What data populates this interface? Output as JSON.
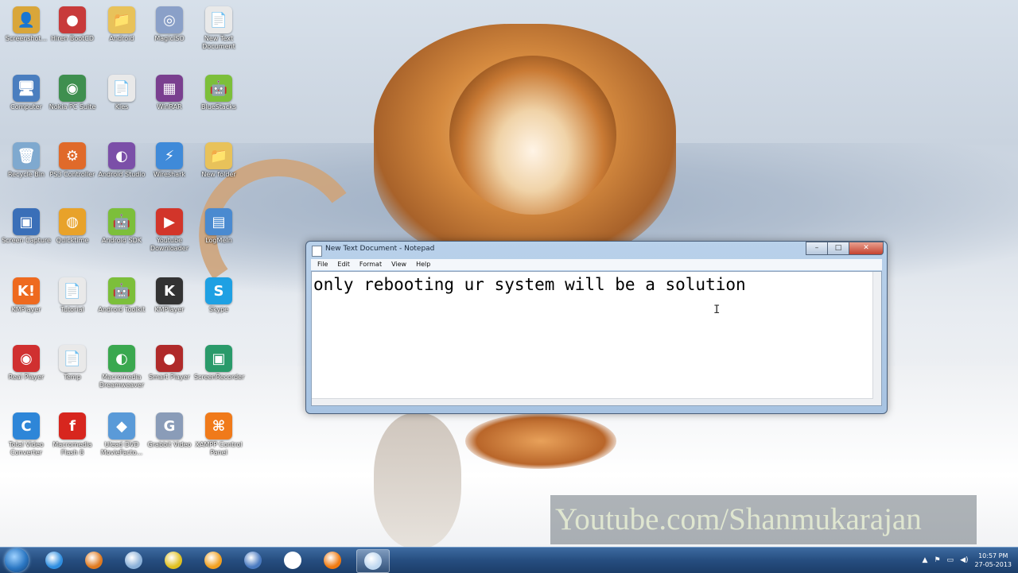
{
  "desktop": {
    "icons": [
      {
        "label": "Screenshot...",
        "glyph": "👤",
        "color": "#d9a63a"
      },
      {
        "label": "Hiren BootCD",
        "glyph": "●",
        "color": "#c83a3a"
      },
      {
        "label": "Android",
        "glyph": "📁",
        "color": "#e8c25a"
      },
      {
        "label": "MagicISO",
        "glyph": "◎",
        "color": "#8aa0c8"
      },
      {
        "label": "New Text Document",
        "glyph": "📄",
        "color": "#e9e9e9"
      },
      {
        "label": "Computer",
        "glyph": "🖥",
        "color": "#4a7ebf"
      },
      {
        "label": "Nokia PC Suite",
        "glyph": "◉",
        "color": "#3f8f4f"
      },
      {
        "label": "Kies",
        "glyph": "📄",
        "color": "#e9e9e9"
      },
      {
        "label": "WinRAR",
        "glyph": "▦",
        "color": "#7a3f8f"
      },
      {
        "label": "BlueStacks",
        "glyph": "🤖",
        "color": "#7cbf3a"
      },
      {
        "label": "Recycle Bin",
        "glyph": "🗑",
        "color": "#7fa9cf"
      },
      {
        "label": "PS3 Controller",
        "glyph": "⚙",
        "color": "#e06a2a"
      },
      {
        "label": "Android Studio",
        "glyph": "◐",
        "color": "#7b4fa8"
      },
      {
        "label": "Wireshark",
        "glyph": "⚡",
        "color": "#3f8ad9"
      },
      {
        "label": "New folder",
        "glyph": "📁",
        "color": "#e8c25a"
      },
      {
        "label": "Screen Capture",
        "glyph": "▣",
        "color": "#3a6fb8"
      },
      {
        "label": "Quicktime",
        "glyph": "◍",
        "color": "#e8a22a"
      },
      {
        "label": "Android SDK",
        "glyph": "🤖",
        "color": "#7cbf3a"
      },
      {
        "label": "Youtube Downloader",
        "glyph": "▶",
        "color": "#d2352a"
      },
      {
        "label": "LogMeIn",
        "glyph": "▤",
        "color": "#4a8ad0"
      },
      {
        "label": "KMPlayer",
        "glyph": "K!",
        "color": "#ee6a1f"
      },
      {
        "label": "Tutorial",
        "glyph": "📄",
        "color": "#e9e9e9"
      },
      {
        "label": "Android Toolkit",
        "glyph": "🤖",
        "color": "#7cbf3a"
      },
      {
        "label": "KMPlayer",
        "glyph": "K",
        "color": "#333333"
      },
      {
        "label": "Skype",
        "glyph": "S",
        "color": "#1ea0e3"
      },
      {
        "label": "Real Player",
        "glyph": "◉",
        "color": "#d03030"
      },
      {
        "label": "Temp",
        "glyph": "📄",
        "color": "#e9e9e9"
      },
      {
        "label": "Macromedia Dreamweaver",
        "glyph": "◐",
        "color": "#3aa84f"
      },
      {
        "label": "Smart Player",
        "glyph": "●",
        "color": "#b02a2a"
      },
      {
        "label": "ScreenRecorder",
        "glyph": "▣",
        "color": "#2a9a6a"
      },
      {
        "label": "Total Video Converter",
        "glyph": "C",
        "color": "#2e86d8"
      },
      {
        "label": "Macromedia Flash 8",
        "glyph": "f",
        "color": "#d7261e"
      },
      {
        "label": "Ulead DVD MovieFacto...",
        "glyph": "◆",
        "color": "#5a9ad8"
      },
      {
        "label": "Grabbit Video",
        "glyph": "G",
        "color": "#8a9cb8"
      },
      {
        "label": "XAMPP Control Panel",
        "glyph": "⌘",
        "color": "#f07a1a"
      }
    ]
  },
  "notepad": {
    "title": "New Text Document - Notepad",
    "menu": [
      "File",
      "Edit",
      "Format",
      "View",
      "Help"
    ],
    "content": "only rebooting ur system will be a solution",
    "minimize": "–",
    "maximize": "□",
    "close": "✕"
  },
  "watermark": "Youtube.com/Shanmukarajan",
  "taskbar": {
    "time": "10:57 PM",
    "date": "27-05-2013",
    "apps": [
      {
        "name": "ie-icon",
        "color": "#2f8ee0"
      },
      {
        "name": "firefox-icon",
        "color": "#e07a20"
      },
      {
        "name": "network-icon",
        "color": "#8ab0d8"
      },
      {
        "name": "chrome-icon",
        "color": "#e0c020"
      },
      {
        "name": "media-player-icon",
        "color": "#f0a020"
      },
      {
        "name": "screen-recorder-icon",
        "color": "#4a7ac0"
      },
      {
        "name": "text-editor-icon",
        "color": "#ffffff"
      },
      {
        "name": "vlc-icon",
        "color": "#f07a10"
      },
      {
        "name": "notepad-icon",
        "color": "#c0d8f0"
      }
    ]
  }
}
